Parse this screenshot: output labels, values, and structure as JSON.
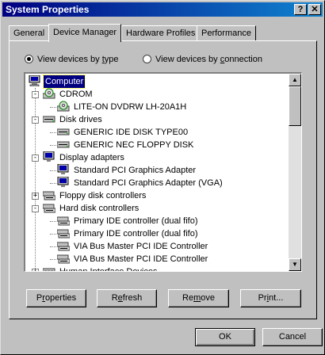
{
  "window": {
    "title": "System Properties",
    "help_btn": "?",
    "close_btn": "✕"
  },
  "tabs": [
    {
      "label": "General",
      "active": false
    },
    {
      "label": "Device Manager",
      "active": true
    },
    {
      "label": "Hardware Profiles",
      "active": false
    },
    {
      "label": "Performance",
      "active": false
    }
  ],
  "view": {
    "by_type": {
      "label_pre": "View devices by ",
      "label_u": "t",
      "label_post": "ype",
      "selected": true
    },
    "by_connection": {
      "label_pre": "View devices by ",
      "label_u": "c",
      "label_post": "onnection",
      "selected": false
    }
  },
  "tree": [
    {
      "label": "Computer",
      "level": 0,
      "icon": "computer-icon",
      "selected": true,
      "expander": ""
    },
    {
      "label": "CDROM",
      "level": 1,
      "icon": "cdrom-icon",
      "expander": "-"
    },
    {
      "label": "LITE-ON DVDRW LH-20A1H",
      "level": 2,
      "icon": "cdrom-icon"
    },
    {
      "label": "Disk drives",
      "level": 1,
      "icon": "disk-drive-icon",
      "expander": "-"
    },
    {
      "label": "GENERIC IDE  DISK TYPE00",
      "level": 2,
      "icon": "disk-drive-icon"
    },
    {
      "label": "GENERIC NEC  FLOPPY DISK",
      "level": 2,
      "icon": "disk-drive-icon"
    },
    {
      "label": "Display adapters",
      "level": 1,
      "icon": "monitor-icon",
      "expander": "-"
    },
    {
      "label": "Standard PCI Graphics Adapter",
      "level": 2,
      "icon": "monitor-icon"
    },
    {
      "label": "Standard PCI Graphics Adapter (VGA)",
      "level": 2,
      "icon": "monitor-icon"
    },
    {
      "label": "Floppy disk controllers",
      "level": 1,
      "icon": "controller-icon",
      "expander": "+"
    },
    {
      "label": "Hard disk controllers",
      "level": 1,
      "icon": "controller-icon",
      "expander": "-"
    },
    {
      "label": "Primary IDE controller (dual fifo)",
      "level": 2,
      "icon": "controller-icon"
    },
    {
      "label": "Primary IDE controller (dual fifo)",
      "level": 2,
      "icon": "controller-icon"
    },
    {
      "label": "VIA Bus Master PCI IDE Controller",
      "level": 2,
      "icon": "controller-icon"
    },
    {
      "label": "VIA Bus Master PCI IDE Controller",
      "level": 2,
      "icon": "controller-icon"
    },
    {
      "label": "Human Interface Devices",
      "level": 1,
      "icon": "hid-icon",
      "expander": "+"
    }
  ],
  "scrollbar": {
    "up": "▲",
    "down": "▼"
  },
  "buttons": {
    "properties": {
      "pre": "P",
      "u": "r",
      "post": "operties"
    },
    "refresh": {
      "pre": "R",
      "u": "e",
      "post": "fresh"
    },
    "remove": {
      "pre": "Re",
      "u": "m",
      "post": "ove"
    },
    "print": {
      "pre": "Pr",
      "u": "i",
      "post": "nt..."
    },
    "ok": "OK",
    "cancel": "Cancel"
  },
  "colors": {
    "title_start": "#000080",
    "title_end": "#1084d0",
    "selection": "#000080",
    "face": "#c0c0c0"
  }
}
